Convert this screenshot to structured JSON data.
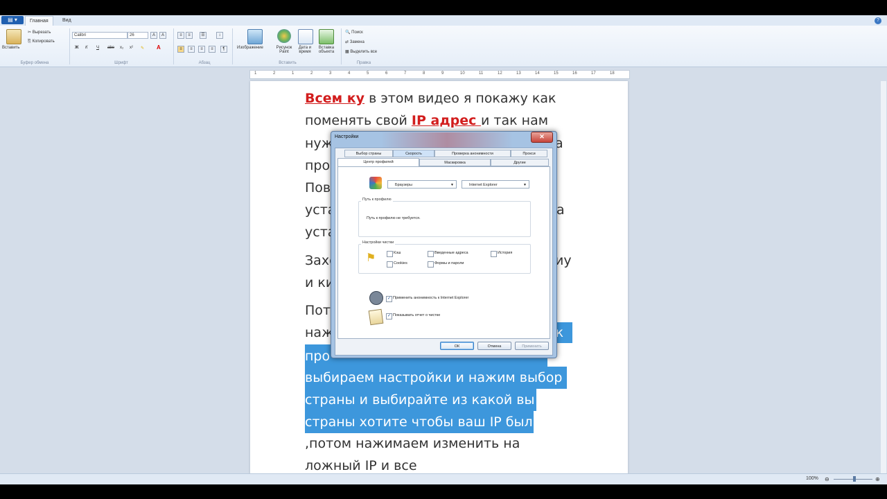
{
  "ribbon": {
    "tabs": [
      "Главная",
      "Вид"
    ],
    "clipboard": {
      "paste": "Вставить",
      "cut": "Вырезать",
      "copy": "Копировать",
      "group": "Буфер обмена"
    },
    "font": {
      "name": "Calibri",
      "size": "26",
      "group": "Шрифт"
    },
    "paragraph": {
      "group": "Абзац"
    },
    "insert": {
      "image": "Изображение",
      "paint": "Рисунок Paint",
      "date": "Дата и время",
      "object": "Вставка объекта",
      "group": "Вставить"
    },
    "edit": {
      "find": "Поиск",
      "replace": "Замена",
      "select_all": "Выделить все",
      "group": "Правка"
    }
  },
  "ruler": {
    "ticks": [
      "1",
      "2",
      "1",
      "2",
      "3",
      "4",
      "5",
      "6",
      "7",
      "8",
      "9",
      "10",
      "11",
      "12",
      "13",
      "14",
      "15",
      "16",
      "17",
      "18"
    ]
  },
  "document": {
    "l1_red": "Всем ку",
    "l1_rest": " в этом видео я покажу как",
    "l2_a": "поменять свой ",
    "l2_red": "IP адрес ",
    "l2_b": "и так нам",
    "l3": "нуж",
    "l3_right": "а",
    "l4": "про",
    "l5": "Пов",
    "l6": "уста",
    "l6_right": "а",
    "l7": "уста",
    "l8": "Захо",
    "l8_right": "иу",
    "l9": "и ки",
    "l10": "Пото",
    "l11": "наж",
    "l11_right": "ок",
    "l12": "про",
    "l13": "выбираем настройки и нажим выбор",
    "l14": "страны и выбирайте из какой вы",
    "l15": "страны хотите чтобы ваш IP был",
    "l16": ",потом нажимаем изменить на",
    "l17": "ложный IP и все"
  },
  "status": {
    "zoom": "100%"
  },
  "dialog": {
    "title": "Настройки",
    "tabs_row1": [
      "Выбор страны",
      "Скорость",
      "Проверка анонимности",
      "Прокси"
    ],
    "tabs_row2": [
      "Центр профилей",
      "Маскировка",
      "Другие"
    ],
    "browser_combo": "Браузеры",
    "ie_combo": "Internet Explorer",
    "profile_path_legend": "Путь к профилю",
    "profile_path_text": "Путь к профилю не требуется.",
    "clean_legend": "Настройки чистки",
    "checks": {
      "cache": "Кэш",
      "typed": "Введенные адреса",
      "history": "История",
      "cookies": "Cookies",
      "forms": "Формы и пароли",
      "apply_ie": "Применить анонимность к Internet Explorer",
      "show_report": "Показывать отчет о чистке"
    },
    "buttons": {
      "ok": "ОК",
      "cancel": "Отмена",
      "apply": "Применить"
    }
  },
  "colors": {
    "accent": "#3d97dc",
    "red_text": "#d21d1d",
    "workspace": "#d4dde9"
  }
}
